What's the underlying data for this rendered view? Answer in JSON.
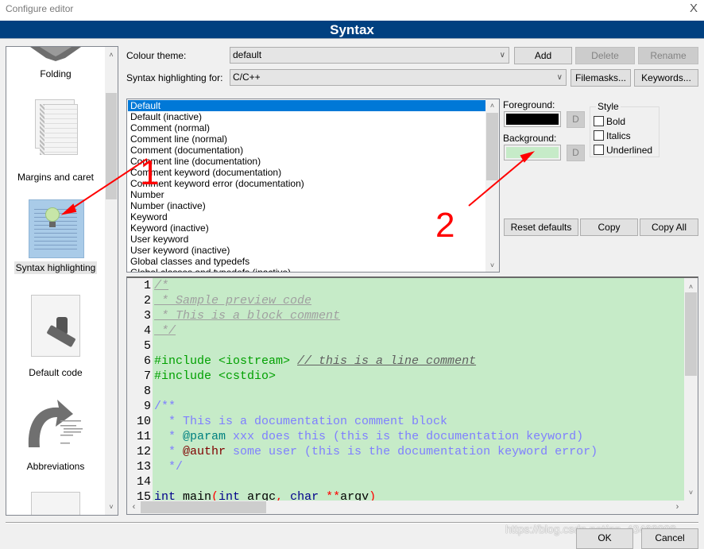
{
  "window": {
    "title": "Configure editor",
    "close_glyph": "X"
  },
  "header": {
    "title": "Syntax"
  },
  "sidebar": {
    "items": [
      {
        "label": "Folding",
        "icon": "folding-icon"
      },
      {
        "label": "Margins and caret",
        "icon": "margins-caret-icon"
      },
      {
        "label": "Syntax highlighting",
        "icon": "syntax-highlighting-icon",
        "selected": true
      },
      {
        "label": "Default code",
        "icon": "default-code-icon"
      },
      {
        "label": "Abbreviations",
        "icon": "abbreviations-icon"
      }
    ],
    "scroll_up": "^",
    "scroll_down": "v"
  },
  "theme": {
    "label": "Colour theme:",
    "value": "default",
    "add": "Add",
    "delete": "Delete",
    "rename": "Rename"
  },
  "highlight": {
    "label": "Syntax highlighting for:",
    "value": "C/C++",
    "filemasks": "Filemasks...",
    "keywords": "Keywords..."
  },
  "style_list": {
    "items": [
      "Default",
      "Default (inactive)",
      "Comment (normal)",
      "Comment line (normal)",
      "Comment (documentation)",
      "Comment line (documentation)",
      "Comment keyword (documentation)",
      "Comment keyword error (documentation)",
      "Number",
      "Number (inactive)",
      "Keyword",
      "Keyword (inactive)",
      "User keyword",
      "User keyword (inactive)",
      "Global classes and typedefs",
      "Global classes and typedefs (inactive)"
    ],
    "selected_index": 0
  },
  "colors": {
    "foreground_label": "Foreground:",
    "foreground_value": "#000000",
    "background_label": "Background:",
    "background_value": "#c6ebc8",
    "default_btn": "D"
  },
  "style": {
    "legend": "Style",
    "bold": "Bold",
    "italics": "Italics",
    "underlined": "Underlined",
    "bold_checked": false,
    "italics_checked": false,
    "underlined_checked": false
  },
  "actions": {
    "reset": "Reset defaults",
    "copy": "Copy",
    "copy_all": "Copy All"
  },
  "preview": {
    "lines": [
      {
        "n": "1",
        "parts": [
          [
            "c-cmt",
            "/*"
          ]
        ]
      },
      {
        "n": "2",
        "parts": [
          [
            "c-cmt",
            " * Sample preview code"
          ]
        ]
      },
      {
        "n": "3",
        "parts": [
          [
            "c-cmt",
            " * This is a block comment"
          ]
        ]
      },
      {
        "n": "4",
        "parts": [
          [
            "c-cmt",
            " */"
          ]
        ]
      },
      {
        "n": "5",
        "parts": []
      },
      {
        "n": "6",
        "parts": [
          [
            "c-pp",
            "#include <iostream> "
          ],
          [
            "c-lcmt",
            "// this is a line comment"
          ]
        ]
      },
      {
        "n": "7",
        "parts": [
          [
            "c-pp",
            "#include <cstdio>"
          ]
        ]
      },
      {
        "n": "8",
        "parts": []
      },
      {
        "n": "9",
        "parts": [
          [
            "c-doc",
            "/**"
          ]
        ]
      },
      {
        "n": "10",
        "parts": [
          [
            "c-doc",
            "  * This is a documentation comment block"
          ]
        ]
      },
      {
        "n": "11",
        "parts": [
          [
            "c-doc",
            "  * "
          ],
          [
            "c-dockw",
            "@param"
          ],
          [
            "c-doc",
            " xxx does this (this is the documentation keyword)"
          ]
        ]
      },
      {
        "n": "12",
        "parts": [
          [
            "c-doc",
            "  * "
          ],
          [
            "c-docerr",
            "@authr"
          ],
          [
            "c-doc",
            " some user (this is the documentation keyword error)"
          ]
        ]
      },
      {
        "n": "13",
        "parts": [
          [
            "c-doc",
            "  */"
          ]
        ]
      },
      {
        "n": "14",
        "parts": []
      },
      {
        "n": "15",
        "parts": [
          [
            "c-kw",
            "int"
          ],
          [
            "",
            " main"
          ],
          [
            "c-op",
            "("
          ],
          [
            "c-kw",
            "int"
          ],
          [
            "",
            " argc"
          ],
          [
            "c-op",
            ","
          ],
          [
            "",
            " "
          ],
          [
            "c-kw",
            "char"
          ],
          [
            "",
            " "
          ],
          [
            "c-op",
            "**"
          ],
          [
            "",
            "argv"
          ],
          [
            "c-op",
            ")"
          ]
        ]
      }
    ]
  },
  "footer": {
    "ok": "OK",
    "cancel": "Cancel",
    "watermark": "https://blog.csdn.net/qq_43468008"
  },
  "annotations": {
    "one": "1",
    "two": "2",
    "color": "#ff0000"
  }
}
